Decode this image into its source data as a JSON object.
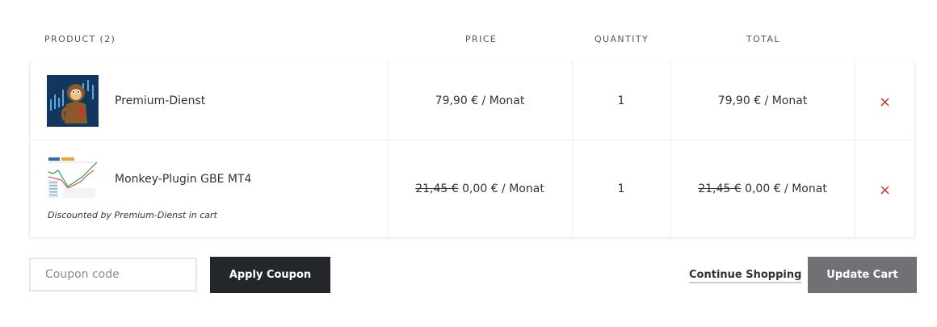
{
  "table": {
    "headers": {
      "product": "PRODUCT (2)",
      "price": "PRICE",
      "quantity": "QUANTITY",
      "total": "TOTAL"
    },
    "items": [
      {
        "name": "Premium-Dienst",
        "price": "79,90 € / Monat",
        "quantity": "1",
        "total": "79,90 € / Monat",
        "remove": "×"
      },
      {
        "name": "Monkey-Plugin GBE MT4",
        "price_old": "21,45 €",
        "price_new": "0,00 € / Monat",
        "quantity": "1",
        "total_old": "21,45 €",
        "total_new": "0,00 € / Monat",
        "remove": "×",
        "note_prefix": "Discounted by",
        "note_link": "Premium-Dienst",
        "note_suffix": "in cart"
      }
    ]
  },
  "actions": {
    "coupon_placeholder": "Coupon code",
    "apply_coupon": "Apply Coupon",
    "continue_shopping": "Continue Shopping",
    "update_cart": "Update Cart"
  },
  "colors": {
    "remove": "#d0392b",
    "apply_button": "#23272b",
    "update_button": "#6f7174"
  }
}
